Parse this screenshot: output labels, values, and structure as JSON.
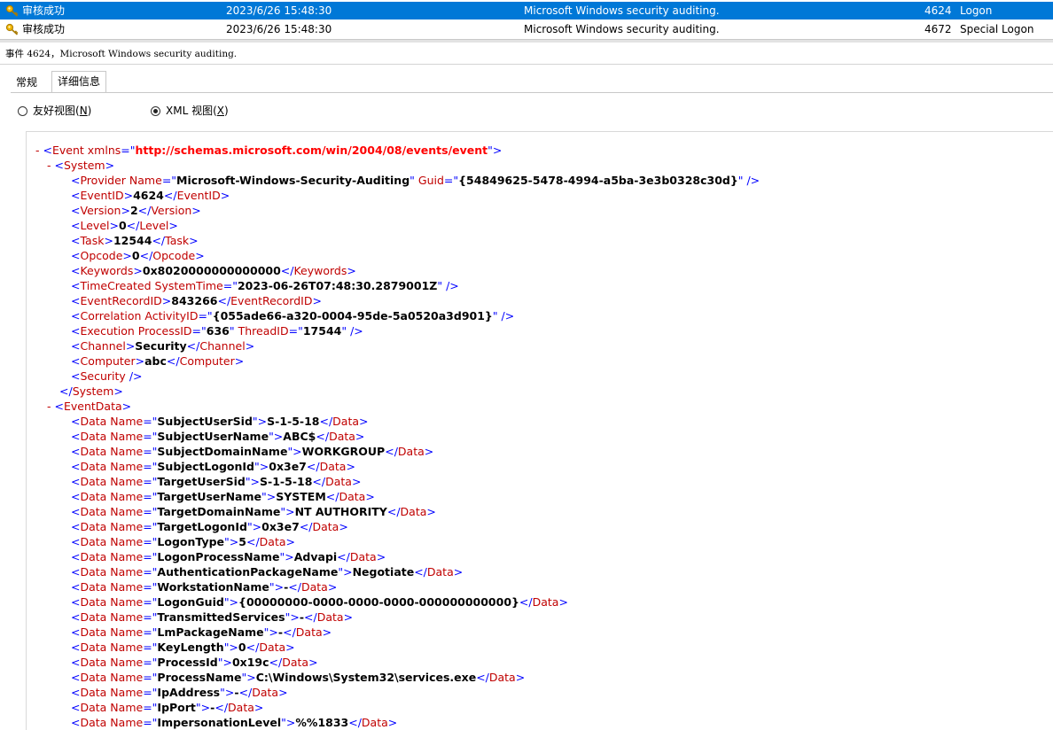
{
  "rows": [
    {
      "level": "审核成功",
      "date": "2023/6/26 15:48:30",
      "source": "Microsoft Windows security auditing.",
      "event_id": "4624",
      "category": "Logon"
    },
    {
      "level": "审核成功",
      "date": "2023/6/26 15:48:30",
      "source": "Microsoft Windows security auditing.",
      "event_id": "4672",
      "category": "Special Logon"
    }
  ],
  "event_title": "事件 4624，Microsoft Windows security auditing.",
  "tabs": {
    "general": "常规",
    "details": "详细信息"
  },
  "views": {
    "friendly": "友好视图(",
    "friendly_key": "N",
    "friendly_end": ")",
    "xml": "XML 视图(",
    "xml_key": "X",
    "xml_end": ")"
  },
  "xml": {
    "event_ns": "http://schemas.microsoft.com/win/2004/08/events/event",
    "system": {
      "provider_name": "Microsoft-Windows-Security-Auditing",
      "provider_guid": "{54849625-5478-4994-a5ba-3e3b0328c30d}",
      "event_id": "4624",
      "version": "2",
      "level": "0",
      "task": "12544",
      "opcode": "0",
      "keywords": "0x8020000000000000",
      "time_created": "2023-06-26T07:48:30.2879001Z",
      "event_record_id": "843266",
      "activity_id": "{055ade66-a320-0004-95de-5a0520a3d901}",
      "process_id": "636",
      "thread_id": "17544",
      "channel": "Security",
      "computer": "abc"
    },
    "event_data": [
      {
        "name": "SubjectUserSid",
        "value": "S-1-5-18"
      },
      {
        "name": "SubjectUserName",
        "value": "ABC$"
      },
      {
        "name": "SubjectDomainName",
        "value": "WORKGROUP"
      },
      {
        "name": "SubjectLogonId",
        "value": "0x3e7"
      },
      {
        "name": "TargetUserSid",
        "value": "S-1-5-18"
      },
      {
        "name": "TargetUserName",
        "value": "SYSTEM"
      },
      {
        "name": "TargetDomainName",
        "value": "NT AUTHORITY"
      },
      {
        "name": "TargetLogonId",
        "value": "0x3e7"
      },
      {
        "name": "LogonType",
        "value": "5"
      },
      {
        "name": "LogonProcessName",
        "value": "Advapi"
      },
      {
        "name": "AuthenticationPackageName",
        "value": "Negotiate"
      },
      {
        "name": "WorkstationName",
        "value": "-"
      },
      {
        "name": "LogonGuid",
        "value": "{00000000-0000-0000-0000-000000000000}"
      },
      {
        "name": "TransmittedServices",
        "value": "-"
      },
      {
        "name": "LmPackageName",
        "value": "-"
      },
      {
        "name": "KeyLength",
        "value": "0"
      },
      {
        "name": "ProcessId",
        "value": "0x19c"
      },
      {
        "name": "ProcessName",
        "value": "C:\\Windows\\System32\\services.exe"
      },
      {
        "name": "IpAddress",
        "value": "-"
      },
      {
        "name": "IpPort",
        "value": "-"
      },
      {
        "name": "ImpersonationLevel",
        "value": "%%1833"
      }
    ]
  }
}
